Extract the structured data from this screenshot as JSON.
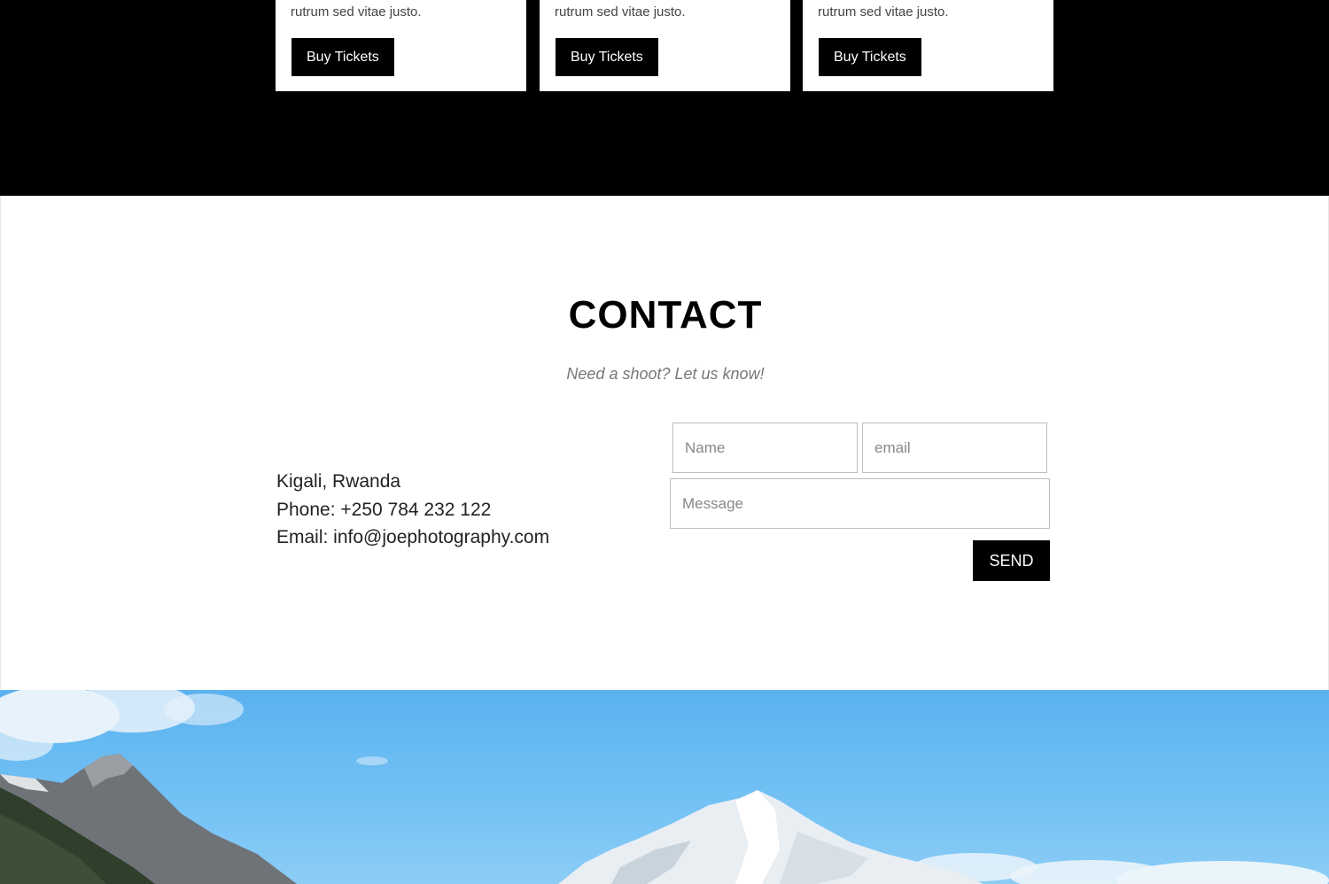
{
  "events": {
    "cards": [
      {
        "text": "rutrum sed vitae justo.",
        "button_label": "Buy Tickets"
      },
      {
        "text": "rutrum sed vitae justo.",
        "button_label": "Buy Tickets"
      },
      {
        "text": "rutrum sed vitae justo.",
        "button_label": "Buy Tickets"
      }
    ]
  },
  "contact": {
    "title": "CONTACT",
    "subtitle": "Need a shoot? Let us know!",
    "info": {
      "location": "Kigali, Rwanda",
      "phone": "Phone: +250 784 232 122",
      "email": "Email: info@joephotography.com"
    },
    "form": {
      "name_placeholder": "Name",
      "email_placeholder": "email",
      "message_placeholder": "Message",
      "send_label": "SEND"
    }
  },
  "colors": {
    "dark_section": "#000000",
    "button_bg": "#000000",
    "sky": "#74c2f5"
  }
}
